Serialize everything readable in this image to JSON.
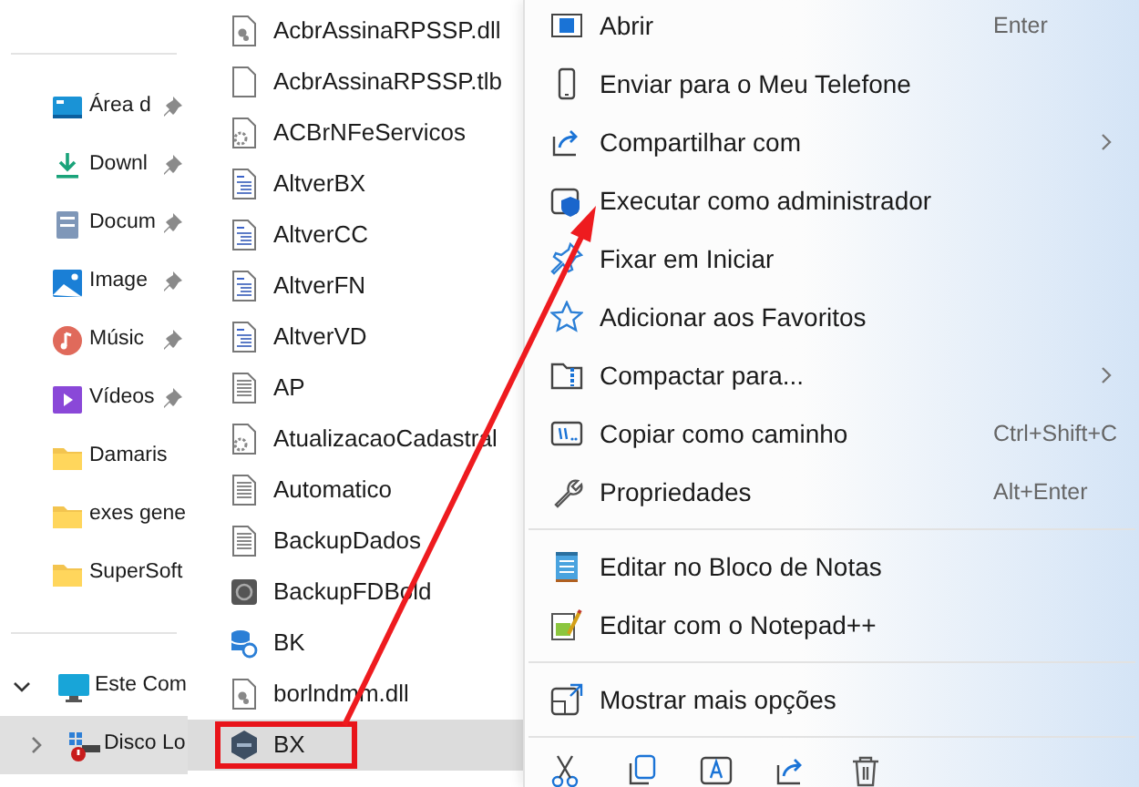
{
  "sidebar": {
    "items": [
      {
        "label": "Área d",
        "kind": "desktop",
        "pinned": true,
        "selected": false
      },
      {
        "label": "Downl",
        "kind": "download",
        "pinned": true,
        "selected": false
      },
      {
        "label": "Docum",
        "kind": "documents",
        "pinned": true,
        "selected": false
      },
      {
        "label": "Image",
        "kind": "pictures",
        "pinned": true,
        "selected": false
      },
      {
        "label": "Músic",
        "kind": "music",
        "pinned": true,
        "selected": false
      },
      {
        "label": "Vídeos",
        "kind": "videos",
        "pinned": true,
        "selected": false
      },
      {
        "label": "Damaris",
        "kind": "folder",
        "pinned": false,
        "selected": false
      },
      {
        "label": "exes gene",
        "kind": "folder",
        "pinned": false,
        "selected": false
      },
      {
        "label": "SuperSoft",
        "kind": "folder",
        "pinned": false,
        "selected": false
      }
    ],
    "drives": [
      {
        "label": "Este Com",
        "kind": "pc",
        "expanded": true,
        "selected": false
      },
      {
        "label": "Disco Lo",
        "kind": "drive",
        "expanded": false,
        "selected": true
      }
    ]
  },
  "files": [
    {
      "name": "AcbrAssinaRPSSP.dll",
      "kind": "dll",
      "selected": false
    },
    {
      "name": "AcbrAssinaRPSSP.tlb",
      "kind": "blank",
      "selected": false
    },
    {
      "name": "ACBrNFeServicos",
      "kind": "gear",
      "selected": false
    },
    {
      "name": "AltverBX",
      "kind": "ini",
      "selected": false
    },
    {
      "name": "AltverCC",
      "kind": "ini",
      "selected": false
    },
    {
      "name": "AltverFN",
      "kind": "ini",
      "selected": false
    },
    {
      "name": "AltverVD",
      "kind": "ini",
      "selected": false
    },
    {
      "name": "AP",
      "kind": "text",
      "selected": false
    },
    {
      "name": "AtualizacaoCadastral",
      "kind": "gear",
      "selected": false
    },
    {
      "name": "Automatico",
      "kind": "text",
      "selected": false
    },
    {
      "name": "BackupDados",
      "kind": "text",
      "selected": false
    },
    {
      "name": "BackupFDBold",
      "kind": "app",
      "selected": false
    },
    {
      "name": "BK",
      "kind": "database",
      "selected": false
    },
    {
      "name": "borlndmm.dll",
      "kind": "dll",
      "selected": false
    },
    {
      "name": "BX",
      "kind": "xml",
      "selected": true
    }
  ],
  "context_menu": {
    "groups": [
      [
        {
          "label": "Abrir",
          "shortcut": "Enter",
          "submenu": false
        },
        {
          "label": "Enviar para o Meu Telefone",
          "submenu": false
        },
        {
          "label": "Compartilhar com",
          "submenu": true
        },
        {
          "label": "Executar como administrador",
          "submenu": false
        },
        {
          "label": "Fixar em Iniciar",
          "submenu": false
        },
        {
          "label": "Adicionar aos Favoritos",
          "submenu": false
        },
        {
          "label": "Compactar para...",
          "submenu": true
        },
        {
          "label": "Copiar como caminho",
          "shortcut": "Ctrl+Shift+C",
          "submenu": false
        },
        {
          "label": "Propriedades",
          "shortcut": "Alt+Enter",
          "submenu": false
        }
      ],
      [
        {
          "label": "Editar no Bloco de Notas",
          "submenu": false
        },
        {
          "label": "Editar com o Notepad++",
          "submenu": false
        }
      ],
      [
        {
          "label": "Mostrar mais opções",
          "submenu": false
        }
      ]
    ]
  }
}
